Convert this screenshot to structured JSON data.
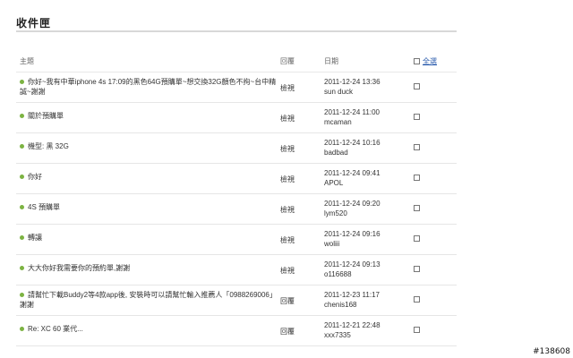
{
  "page": {
    "title": "收件匣",
    "tag": "#138608"
  },
  "header": {
    "subject": "主題",
    "reply": "回覆",
    "date": "日期",
    "select_all": "全選"
  },
  "messages": [
    {
      "subject": "你好~我有中華iphone 4s 17:09的黑色64G預購單~想交換32G顏色不拘~台中精誠~謝謝",
      "reply": "檢視",
      "date": "2011-12-24 13:36",
      "sender": "sun duck"
    },
    {
      "subject": "關於預購單",
      "reply": "檢視",
      "date": "2011-12-24 11:00",
      "sender": "mcaman"
    },
    {
      "subject": "機型: 黑 32G",
      "reply": "檢視",
      "date": "2011-12-24 10:16",
      "sender": "badbad"
    },
    {
      "subject": "你好",
      "reply": "檢視",
      "date": "2011-12-24 09:41",
      "sender": "APOL"
    },
    {
      "subject": "4S 預購單",
      "reply": "檢視",
      "date": "2011-12-24 09:20",
      "sender": "lym520"
    },
    {
      "subject": "轉讓",
      "reply": "檢視",
      "date": "2011-12-24 09:16",
      "sender": "woliii"
    },
    {
      "subject": "大大你好我需要你的預約單,謝謝",
      "reply": "檢視",
      "date": "2011-12-24 09:13",
      "sender": "o116688"
    },
    {
      "subject": "請幫忙下載Buddy2等4款app後, 安裝時可以請幫忙輸入推薦人「0988269006」謝謝",
      "reply": "回覆",
      "date": "2011-12-23 11:17",
      "sender": "chenis168"
    },
    {
      "subject": "Re: XC 60 業代...",
      "reply": "回覆",
      "date": "2011-12-21 22:48",
      "sender": "xxx7335"
    }
  ]
}
